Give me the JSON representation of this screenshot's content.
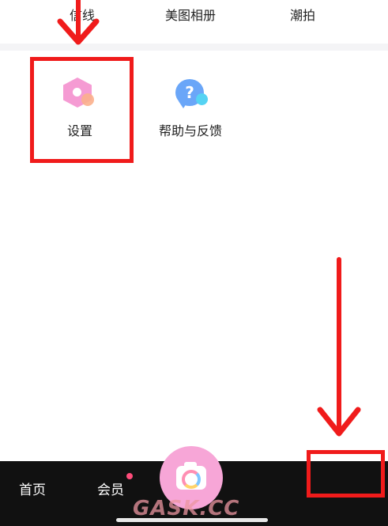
{
  "top_menu": {
    "items": [
      {
        "label": "信线"
      },
      {
        "label": "美图相册"
      },
      {
        "label": "潮拍"
      }
    ]
  },
  "tools": [
    {
      "label": "设置",
      "icon": "settings-gear-icon"
    },
    {
      "label": "帮助与反馈",
      "icon": "help-question-icon",
      "icon_text": "?"
    }
  ],
  "bottom_nav": {
    "items": [
      {
        "label": "首页"
      },
      {
        "label": "会员",
        "has_badge": true
      }
    ],
    "center_action": {
      "icon": "camera-icon"
    }
  },
  "annotations": {
    "highlight_color": "#f01b1b",
    "arrows": 2
  },
  "watermark": {
    "text": "GASK.CC"
  },
  "colors": {
    "accent_pink": "#f7a6d7",
    "nav_background": "#111111",
    "help_blue": "#6aa6f8"
  }
}
